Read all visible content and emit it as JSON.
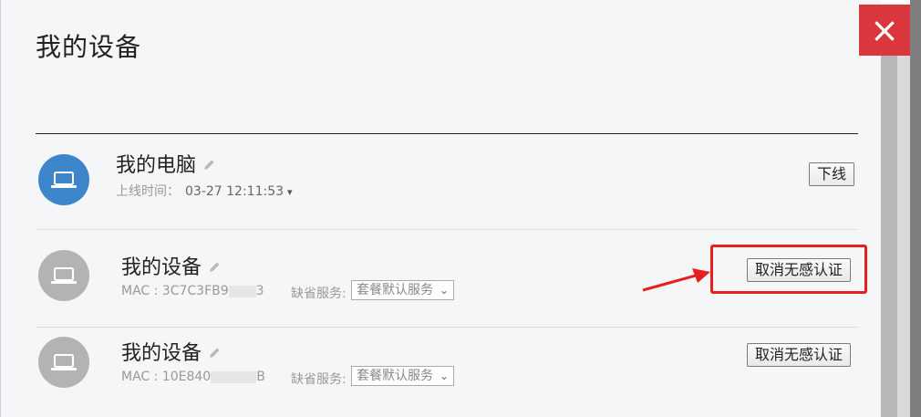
{
  "modal": {
    "title": "我的设备",
    "close_icon": "×"
  },
  "devices": [
    {
      "name": "我的电脑",
      "online_label": "上线时间：",
      "online_time": "03-27 12:11:53",
      "caret": "▾",
      "action": "下线",
      "avatar_color": "#3d86cc",
      "icon": "laptop-icon"
    },
    {
      "name": "我的设备",
      "mac_prefix": "MAC : 3C7C3FB9",
      "mac_suffix": "3",
      "service_label": "缺省服务:",
      "service_value": "套餐默认服务",
      "action": "取消无感认证",
      "avatar_color": "#b3b3b3",
      "icon": "laptop-icon"
    },
    {
      "name": "我的设备",
      "mac_prefix": "MAC : 10E840",
      "mac_suffix": "B",
      "service_label": "缺省服务:",
      "service_value": "套餐默认服务",
      "action": "取消无感认证",
      "avatar_color": "#b3b3b3",
      "icon": "laptop-icon"
    }
  ],
  "annotation": {
    "highlight_color": "#e81f1f"
  }
}
